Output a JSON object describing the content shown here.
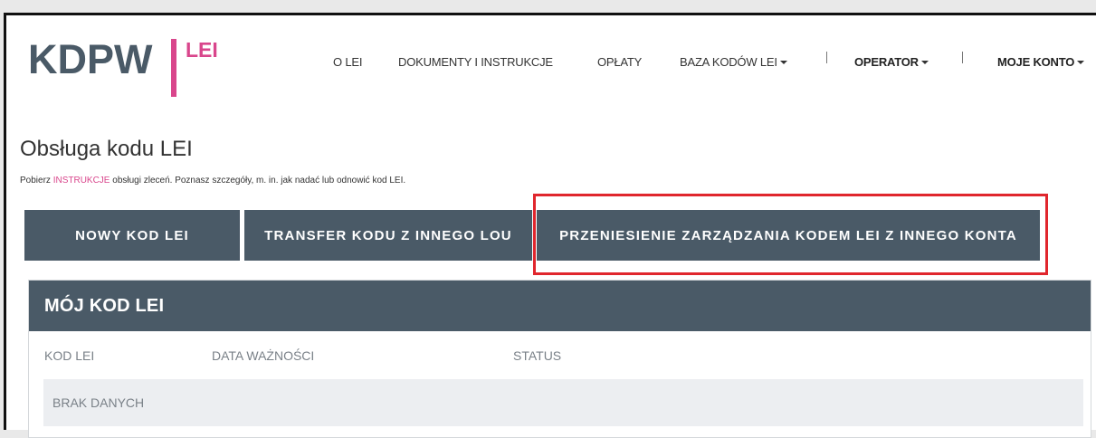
{
  "logo": {
    "brand": "KDPW",
    "suffix": "LEI"
  },
  "nav": {
    "items": [
      "O LEI",
      "DOKUMENTY I INSTRUKCJE",
      "OPŁATY",
      "BAZA KODÓW LEI"
    ],
    "operator": "OPERATOR",
    "account": "MOJE KONTO"
  },
  "page": {
    "title": "Obsługa kodu LEI",
    "subtitle_before": "Pobierz ",
    "subtitle_link": "INSTRUKCJE",
    "subtitle_after": " obsługi zleceń. Poznasz szczegóły, m. in. jak nadać lub odnowić kod LEI."
  },
  "actions": {
    "new_code": "NOWY KOD LEI",
    "transfer": "TRANSFER KODU Z INNEGO LOU",
    "move_management": "PRZENIESIENIE ZARZĄDZANIA KODEM LEI Z INNEGO KONTA"
  },
  "panel": {
    "title": "MÓJ KOD LEI",
    "columns": [
      "KOD LEI",
      "DATA WAŻNOŚCI",
      "STATUS"
    ],
    "empty": "BRAK DANYCH"
  },
  "colors": {
    "accent": "#d9468c",
    "header": "#4a5a67",
    "highlight": "#e0262d"
  }
}
